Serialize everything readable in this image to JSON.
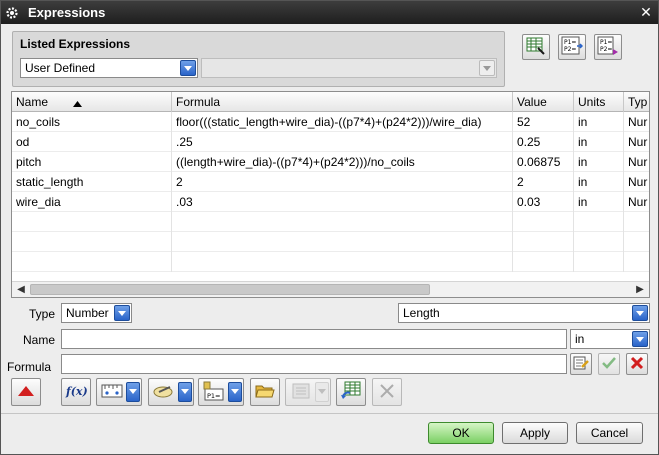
{
  "window": {
    "title": "Expressions"
  },
  "listed": {
    "label": "Listed Expressions",
    "filter_value": "User Defined",
    "secondary_value": ""
  },
  "table": {
    "columns": [
      "Name",
      "Formula",
      "Value",
      "Units",
      "Typ"
    ],
    "rows": [
      {
        "name": "no_coils",
        "formula": "floor(((static_length+wire_dia)-((p7*4)+(p24*2)))/wire_dia)",
        "value": "52",
        "units": "in",
        "type": "Nur"
      },
      {
        "name": "od",
        "formula": ".25",
        "value": "0.25",
        "units": "in",
        "type": "Nur"
      },
      {
        "name": "pitch",
        "formula": "((length+wire_dia)-((p7*4)+(p24*2)))/no_coils",
        "value": "0.06875",
        "units": "in",
        "type": "Nur"
      },
      {
        "name": "static_length",
        "formula": "2",
        "value": "2",
        "units": "in",
        "type": "Nur"
      },
      {
        "name": "wire_dia",
        "formula": ".03",
        "value": "0.03",
        "units": "in",
        "type": "Nur"
      }
    ]
  },
  "form": {
    "type_label": "Type",
    "type_value": "Number",
    "dimension_value": "Length",
    "name_label": "Name",
    "name_value": "",
    "units_value": "in",
    "formula_label": "Formula",
    "formula_value": ""
  },
  "buttons": {
    "ok": "OK",
    "apply": "Apply",
    "cancel": "Cancel"
  },
  "colors": {
    "titlebar": "#2b2b2b",
    "accent_blue": "#2a64c9",
    "ok_green": "#7bd064",
    "delete_red": "#d21f1f"
  }
}
